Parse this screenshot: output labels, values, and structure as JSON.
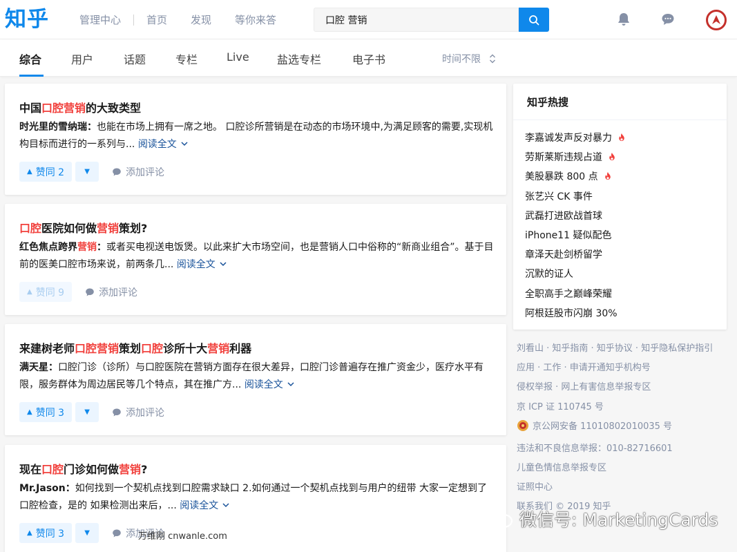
{
  "header": {
    "logo": "知乎",
    "nav": [
      "管理中心",
      "首页",
      "发现",
      "等你来答"
    ],
    "search_value": "口腔 营销",
    "colors": {
      "brand": "#0f88eb",
      "highlight": "#f1403c"
    }
  },
  "tabs": {
    "items": [
      "综合",
      "用户",
      "话题",
      "专栏",
      "Live",
      "盐选专栏",
      "电子书"
    ],
    "active": "综合",
    "time_filter": "时间不限"
  },
  "results": [
    {
      "title_parts": [
        {
          "t": "中国",
          "h": false
        },
        {
          "t": "口腔营销",
          "h": true
        },
        {
          "t": "的大致类型",
          "h": false
        }
      ],
      "author": "时光里的雪纳瑞",
      "excerpt_parts": [
        {
          "t": "也能在市场上拥有一席之地。 口腔诊所营销是在动态的市场环境中,为满足顾客的需要,实现机构目标而进行的一系列与...",
          "h": false
        }
      ],
      "read_more": "阅读全文",
      "vote_label": "赞同 2",
      "vote_faded": false,
      "comment_label": "添加评论"
    },
    {
      "title_parts": [
        {
          "t": "口腔",
          "h": true
        },
        {
          "t": "医院如何做",
          "h": false
        },
        {
          "t": "营销",
          "h": true
        },
        {
          "t": "策划?",
          "h": false
        }
      ],
      "author": "红色焦点跨界",
      "author_hl": "营销",
      "excerpt_parts": [
        {
          "t": "或者买电视送电饭煲。以此来扩大市场空间，也是营销人口中俗称的“新商业组合”。基于目前的医美口腔市场来说，前两条几...",
          "h": false
        }
      ],
      "read_more": "阅读全文",
      "vote_label": "赞同 9",
      "vote_faded": true,
      "comment_label": "添加评论"
    },
    {
      "title_parts": [
        {
          "t": "来建树老师",
          "h": false
        },
        {
          "t": "口腔营销",
          "h": true
        },
        {
          "t": "策划",
          "h": false
        },
        {
          "t": "口腔",
          "h": true
        },
        {
          "t": "诊所十大",
          "h": false
        },
        {
          "t": "营销",
          "h": true
        },
        {
          "t": "利器",
          "h": false
        }
      ],
      "author": "满天星",
      "excerpt_parts": [
        {
          "t": "口腔门诊（诊所）与口腔医院在营销方面存在很大差异，口腔门诊普遍存在推广资金少，医疗水平有限，服务群体为周边居民等几个特点，其在推广方...",
          "h": false
        }
      ],
      "read_more": "阅读全文",
      "vote_label": "赞同 3",
      "vote_faded": false,
      "comment_label": "添加评论"
    },
    {
      "title_parts": [
        {
          "t": "现在",
          "h": false
        },
        {
          "t": "口腔",
          "h": true
        },
        {
          "t": "门诊如何做",
          "h": false
        },
        {
          "t": "营销",
          "h": true
        },
        {
          "t": "?",
          "h": false
        }
      ],
      "author": "Mr.Jason",
      "excerpt_parts": [
        {
          "t": "如何找到一个契机点找到口腔需求缺口 2.如何通过一个契机点找到与用户的纽带 大家一定想到了口腔检查，是的 如果检测出来后，...",
          "h": false
        }
      ],
      "read_more": "阅读全文",
      "vote_label": "赞同 3",
      "vote_faded": false,
      "comment_label": "添加评论"
    }
  ],
  "sidebar": {
    "hot_title": "知乎热搜",
    "hot_items": [
      {
        "text": "李嘉诚发声反对暴力",
        "fire": true
      },
      {
        "text": "劳斯莱斯违规占道",
        "fire": true
      },
      {
        "text": "美股暴跌 800 点",
        "fire": true
      },
      {
        "text": "张艺兴 CK 事件",
        "fire": false
      },
      {
        "text": "武磊打进欧战首球",
        "fire": false
      },
      {
        "text": "iPhone11 疑似配色",
        "fire": false
      },
      {
        "text": "章泽天赴剑桥留学",
        "fire": false
      },
      {
        "text": "沉默的证人",
        "fire": false
      },
      {
        "text": "全职高手之巅峰荣耀",
        "fire": false
      },
      {
        "text": "阿根廷股市闪崩 30%",
        "fire": false
      }
    ],
    "footer_lines": [
      "刘看山 · 知乎指南 · 知乎协议 · 知乎隐私保护指引",
      "应用 · 工作 · 申请开通知乎机构号",
      "侵权举报 · 网上有害信息举报专区",
      "京 ICP 证 110745 号",
      "京公网安备 11010802010035 号",
      "违法和不良信息举报：010-82716601",
      "儿童色情信息举报专区",
      "证照中心",
      "联系我们 © 2019 知乎"
    ]
  },
  "watermark": {
    "wechat": "微信号: MarketingCards",
    "site": "万维刚 cnwanle.com"
  }
}
